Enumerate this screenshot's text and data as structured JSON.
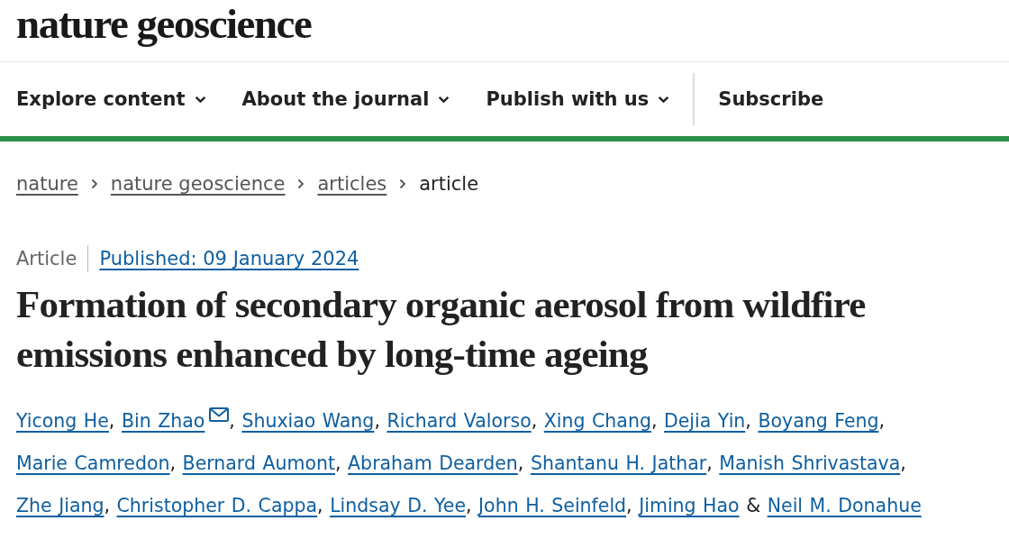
{
  "logo": "nature geoscience",
  "nav": [
    {
      "label": "Explore content",
      "dropdown": true
    },
    {
      "label": "About the journal",
      "dropdown": true
    },
    {
      "label": "Publish with us",
      "dropdown": true
    },
    {
      "label": "Subscribe",
      "dropdown": false
    }
  ],
  "breadcrumbs": [
    {
      "label": "nature",
      "current": false
    },
    {
      "label": "nature geoscience",
      "current": false
    },
    {
      "label": "articles",
      "current": false
    },
    {
      "label": "article",
      "current": true
    }
  ],
  "article_type": "Article",
  "published": "Published: 09 January 2024",
  "title": "Formation of secondary organic aerosol from wildfire emissions enhanced by long-time ageing",
  "authors": [
    {
      "name": "Yicong He",
      "corresponding": false,
      "sep": ","
    },
    {
      "name": "Bin Zhao",
      "corresponding": true,
      "sep": ","
    },
    {
      "name": "Shuxiao Wang",
      "corresponding": false,
      "sep": ","
    },
    {
      "name": "Richard Valorso",
      "corresponding": false,
      "sep": ","
    },
    {
      "name": "Xing Chang",
      "corresponding": false,
      "sep": ","
    },
    {
      "name": "Dejia Yin",
      "corresponding": false,
      "sep": ","
    },
    {
      "name": "Boyang Feng",
      "corresponding": false,
      "sep": ","
    },
    {
      "name": "Marie Camredon",
      "corresponding": false,
      "sep": ","
    },
    {
      "name": "Bernard Aumont",
      "corresponding": false,
      "sep": ","
    },
    {
      "name": "Abraham Dearden",
      "corresponding": false,
      "sep": ","
    },
    {
      "name": "Shantanu H. Jathar",
      "corresponding": false,
      "sep": ","
    },
    {
      "name": "Manish Shrivastava",
      "corresponding": false,
      "sep": ","
    },
    {
      "name": "Zhe Jiang",
      "corresponding": false,
      "sep": ","
    },
    {
      "name": "Christopher D. Cappa",
      "corresponding": false,
      "sep": ","
    },
    {
      "name": "Lindsay D. Yee",
      "corresponding": false,
      "sep": ","
    },
    {
      "name": "John H. Seinfeld",
      "corresponding": false,
      "sep": ","
    },
    {
      "name": "Jiming Hao",
      "corresponding": false,
      "sep": "&"
    },
    {
      "name": "Neil M. Donahue",
      "corresponding": false
    }
  ]
}
